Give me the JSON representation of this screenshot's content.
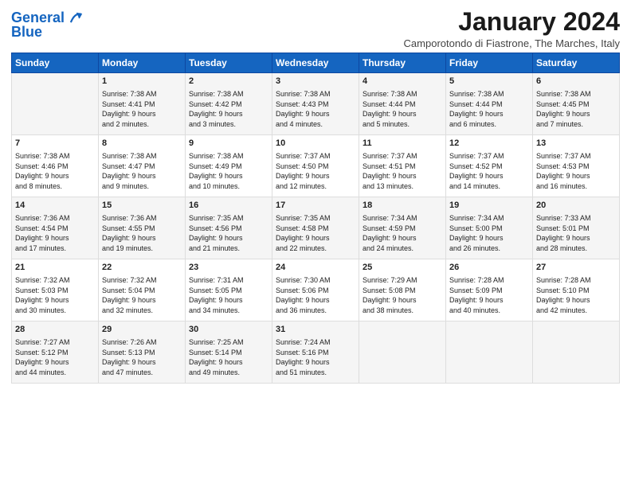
{
  "header": {
    "logo_line1": "General",
    "logo_line2": "Blue",
    "title": "January 2024",
    "location": "Camporotondo di Fiastrone, The Marches, Italy"
  },
  "days_header": [
    "Sunday",
    "Monday",
    "Tuesday",
    "Wednesday",
    "Thursday",
    "Friday",
    "Saturday"
  ],
  "weeks": [
    [
      {
        "day": "",
        "content": ""
      },
      {
        "day": "1",
        "content": "Sunrise: 7:38 AM\nSunset: 4:41 PM\nDaylight: 9 hours\nand 2 minutes."
      },
      {
        "day": "2",
        "content": "Sunrise: 7:38 AM\nSunset: 4:42 PM\nDaylight: 9 hours\nand 3 minutes."
      },
      {
        "day": "3",
        "content": "Sunrise: 7:38 AM\nSunset: 4:43 PM\nDaylight: 9 hours\nand 4 minutes."
      },
      {
        "day": "4",
        "content": "Sunrise: 7:38 AM\nSunset: 4:44 PM\nDaylight: 9 hours\nand 5 minutes."
      },
      {
        "day": "5",
        "content": "Sunrise: 7:38 AM\nSunset: 4:44 PM\nDaylight: 9 hours\nand 6 minutes."
      },
      {
        "day": "6",
        "content": "Sunrise: 7:38 AM\nSunset: 4:45 PM\nDaylight: 9 hours\nand 7 minutes."
      }
    ],
    [
      {
        "day": "7",
        "content": "Sunrise: 7:38 AM\nSunset: 4:46 PM\nDaylight: 9 hours\nand 8 minutes."
      },
      {
        "day": "8",
        "content": "Sunrise: 7:38 AM\nSunset: 4:47 PM\nDaylight: 9 hours\nand 9 minutes."
      },
      {
        "day": "9",
        "content": "Sunrise: 7:38 AM\nSunset: 4:49 PM\nDaylight: 9 hours\nand 10 minutes."
      },
      {
        "day": "10",
        "content": "Sunrise: 7:37 AM\nSunset: 4:50 PM\nDaylight: 9 hours\nand 12 minutes."
      },
      {
        "day": "11",
        "content": "Sunrise: 7:37 AM\nSunset: 4:51 PM\nDaylight: 9 hours\nand 13 minutes."
      },
      {
        "day": "12",
        "content": "Sunrise: 7:37 AM\nSunset: 4:52 PM\nDaylight: 9 hours\nand 14 minutes."
      },
      {
        "day": "13",
        "content": "Sunrise: 7:37 AM\nSunset: 4:53 PM\nDaylight: 9 hours\nand 16 minutes."
      }
    ],
    [
      {
        "day": "14",
        "content": "Sunrise: 7:36 AM\nSunset: 4:54 PM\nDaylight: 9 hours\nand 17 minutes."
      },
      {
        "day": "15",
        "content": "Sunrise: 7:36 AM\nSunset: 4:55 PM\nDaylight: 9 hours\nand 19 minutes."
      },
      {
        "day": "16",
        "content": "Sunrise: 7:35 AM\nSunset: 4:56 PM\nDaylight: 9 hours\nand 21 minutes."
      },
      {
        "day": "17",
        "content": "Sunrise: 7:35 AM\nSunset: 4:58 PM\nDaylight: 9 hours\nand 22 minutes."
      },
      {
        "day": "18",
        "content": "Sunrise: 7:34 AM\nSunset: 4:59 PM\nDaylight: 9 hours\nand 24 minutes."
      },
      {
        "day": "19",
        "content": "Sunrise: 7:34 AM\nSunset: 5:00 PM\nDaylight: 9 hours\nand 26 minutes."
      },
      {
        "day": "20",
        "content": "Sunrise: 7:33 AM\nSunset: 5:01 PM\nDaylight: 9 hours\nand 28 minutes."
      }
    ],
    [
      {
        "day": "21",
        "content": "Sunrise: 7:32 AM\nSunset: 5:03 PM\nDaylight: 9 hours\nand 30 minutes."
      },
      {
        "day": "22",
        "content": "Sunrise: 7:32 AM\nSunset: 5:04 PM\nDaylight: 9 hours\nand 32 minutes."
      },
      {
        "day": "23",
        "content": "Sunrise: 7:31 AM\nSunset: 5:05 PM\nDaylight: 9 hours\nand 34 minutes."
      },
      {
        "day": "24",
        "content": "Sunrise: 7:30 AM\nSunset: 5:06 PM\nDaylight: 9 hours\nand 36 minutes."
      },
      {
        "day": "25",
        "content": "Sunrise: 7:29 AM\nSunset: 5:08 PM\nDaylight: 9 hours\nand 38 minutes."
      },
      {
        "day": "26",
        "content": "Sunrise: 7:28 AM\nSunset: 5:09 PM\nDaylight: 9 hours\nand 40 minutes."
      },
      {
        "day": "27",
        "content": "Sunrise: 7:28 AM\nSunset: 5:10 PM\nDaylight: 9 hours\nand 42 minutes."
      }
    ],
    [
      {
        "day": "28",
        "content": "Sunrise: 7:27 AM\nSunset: 5:12 PM\nDaylight: 9 hours\nand 44 minutes."
      },
      {
        "day": "29",
        "content": "Sunrise: 7:26 AM\nSunset: 5:13 PM\nDaylight: 9 hours\nand 47 minutes."
      },
      {
        "day": "30",
        "content": "Sunrise: 7:25 AM\nSunset: 5:14 PM\nDaylight: 9 hours\nand 49 minutes."
      },
      {
        "day": "31",
        "content": "Sunrise: 7:24 AM\nSunset: 5:16 PM\nDaylight: 9 hours\nand 51 minutes."
      },
      {
        "day": "",
        "content": ""
      },
      {
        "day": "",
        "content": ""
      },
      {
        "day": "",
        "content": ""
      }
    ]
  ]
}
